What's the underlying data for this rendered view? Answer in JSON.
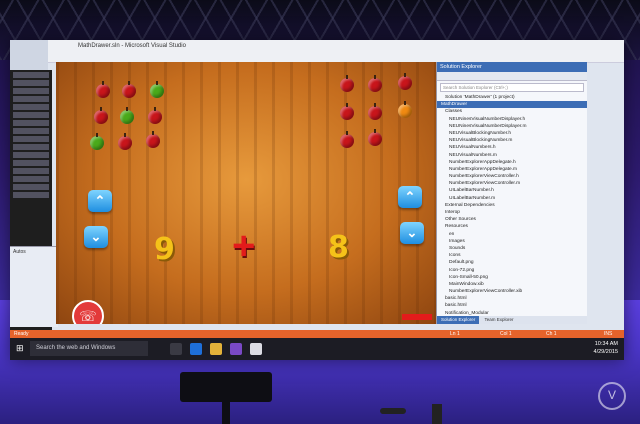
{
  "vs": {
    "title": "MathDrawer.sln - Microsoft Visual Studio",
    "left_panel_label": "Autos"
  },
  "simulator": {
    "digit_left": "9",
    "digit_right": "8",
    "plus_symbol": "+",
    "divide_symbol": "÷",
    "times_symbol": "✕",
    "up_arrow": "⌃",
    "down_arrow": "⌄",
    "phone_icon": "☏"
  },
  "solution_explorer": {
    "title": "Solution Explorer",
    "search_placeholder": "Search Solution Explorer (Ctrl+;)",
    "items": [
      "Solution 'MathDrawer' (1 project)",
      "MathDrawer",
      "Classes",
      "NEUNinesVisualNumberDisplayer.h",
      "NEUNinesVisualNumberDisplayer.m",
      "NEUVisualBlockingNumber.h",
      "NEUVisualBlockingNumber.m",
      "NEUVisualNumbers.h",
      "NEUVisualNumbers.m",
      "NumberExplorerAppDelegate.h",
      "NumberExplorerAppDelegate.m",
      "NumberExplorerViewController.h",
      "NumberExplorerViewController.m",
      "UILabelBarNumber.h",
      "UILabelBarNumber.m",
      "External Dependencies",
      "Interop",
      "Other Sources",
      "Resources",
      "en",
      "Images",
      "Sounds",
      "Icons",
      "Default.png",
      "Icon-72.png",
      "Icon-Small-50.png",
      "MainWindow.xib",
      "NumberExplorerViewController.xib",
      "basic.html",
      "basic.html",
      "Notification_Modular"
    ],
    "tab_solution": "Solution Explorer",
    "tab_team": "Team Explorer"
  },
  "status": {
    "left": "Ready",
    "ln": "Ln 1",
    "col": "Col 1",
    "ch": "Ch 1",
    "ins": "INS"
  },
  "taskbar": {
    "search_placeholder": "Search the web and Windows",
    "time": "10:34 AM",
    "date": "4/29/2015"
  },
  "watermark": "V",
  "colors": {
    "accent_status": "#e5632b",
    "solution_selected": "#3c6db5",
    "operator_red": "#e31b1b",
    "digit_yellow": "#f5c219"
  }
}
